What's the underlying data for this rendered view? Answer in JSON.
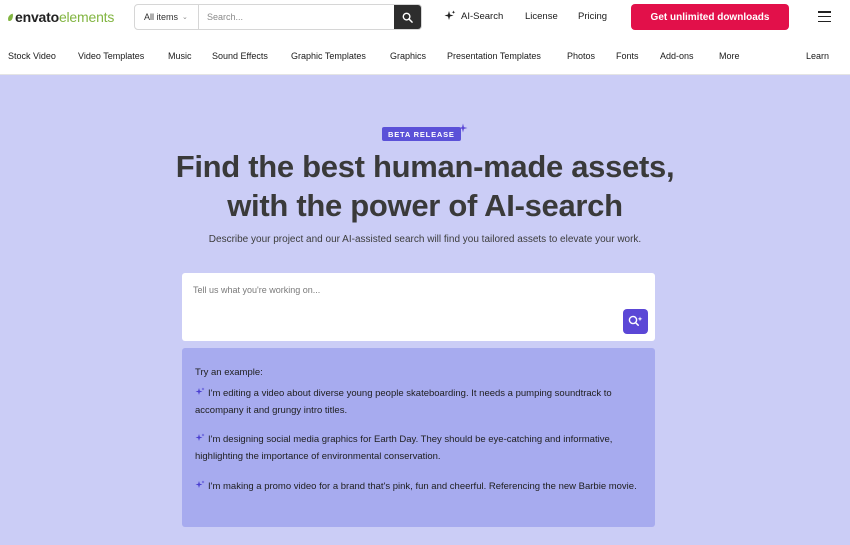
{
  "header": {
    "logo_part1": "envato",
    "logo_part2": "elements",
    "search": {
      "scope_label": "All items",
      "placeholder": "Search..."
    },
    "links": {
      "ai_search": "AI-Search",
      "license": "License",
      "pricing": "Pricing"
    },
    "cta_label": "Get unlimited downloads"
  },
  "categories": [
    "Stock Video",
    "Video Templates",
    "Music",
    "Sound Effects",
    "Graphic Templates",
    "Graphics",
    "Presentation Templates",
    "Photos",
    "Fonts",
    "Add-ons",
    "More",
    "Learn"
  ],
  "hero": {
    "badge": "BETA RELEASE",
    "headline_line1": "Find the best human-made assets,",
    "headline_line2": "with the power of AI-search",
    "subline": "Describe your project and our AI-assisted search will find you tailored assets to elevate your work.",
    "prompt_placeholder": "Tell us what you're working on..."
  },
  "examples": {
    "title": "Try an example:",
    "items": [
      "I'm editing a video about diverse young people skateboarding. It needs a pumping soundtrack to accompany it and grungy intro titles.",
      "I'm designing social media graphics for Earth Day. They should be eye-catching and informative, highlighting the importance of environmental conservation.",
      "I'm making a promo video for a brand that's pink, fun and cheerful. Referencing the new Barbie movie."
    ]
  },
  "colors": {
    "background": "#cbcdf6",
    "accent_purple": "#5b47d6",
    "cta_red": "#e2104a",
    "logo_green": "#82b541",
    "examples_panel": "#a7abef"
  }
}
